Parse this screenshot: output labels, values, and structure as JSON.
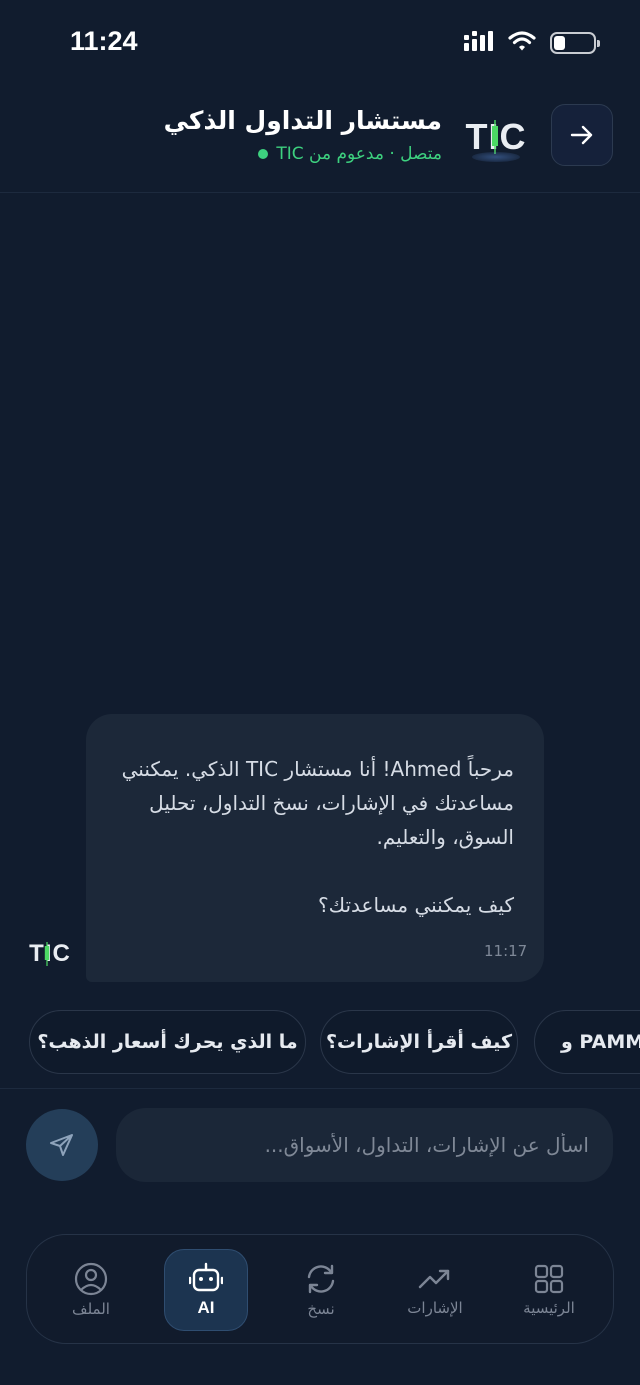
{
  "status_bar": {
    "time": "11:24",
    "battery_level": 0.3
  },
  "header": {
    "title": "مستشار التداول الذكي",
    "subtitle": "متصل · مدعوم من TIC",
    "logo_text": "TIC"
  },
  "message": {
    "text": "مرحباً Ahmed! أنا مستشار TIC الذكي. يمكنني مساعدتك في الإشارات، نسخ التداول، تحليل السوق، والتعليم.\n\nكيف يمكنني مساعدتك؟",
    "time": "11:17",
    "avatar_text": "TIC"
  },
  "suggestions": [
    "ما الذي يحرك أسعار الذهب؟",
    "كيف أقرأ الإشارات؟",
    "و PAMM؟"
  ],
  "input": {
    "placeholder": "اسأل عن الإشارات، التداول، الأسواق..."
  },
  "nav": [
    {
      "label": "الرئيسية"
    },
    {
      "label": "الإشارات"
    },
    {
      "label": "نسخ"
    },
    {
      "label": "AI"
    },
    {
      "label": "الملف"
    }
  ],
  "colors": {
    "background": "#111c2e",
    "online": "#3dd17f",
    "accent_candle": "#4cd964",
    "active_nav": "#1c3450"
  }
}
